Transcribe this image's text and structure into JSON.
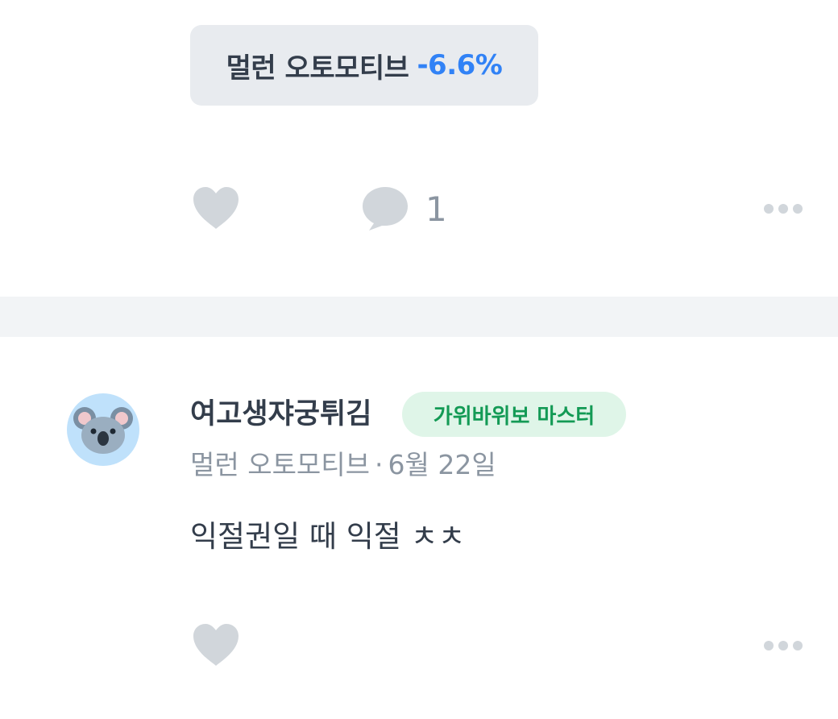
{
  "post": {
    "stock_tag": {
      "name": "멀런 오토모티브",
      "change": "-6.6%"
    },
    "actions": {
      "comment_count": "1"
    }
  },
  "comment": {
    "user": {
      "name": "여고생쟈궁튀김",
      "badge": "가위바위보 마스터",
      "avatar_icon": "koala-icon"
    },
    "meta": {
      "stock": "멀런 오토모티브",
      "separator": "·",
      "date": "6월 22일"
    },
    "text": "익절권일 때 익절 ㅊㅊ"
  },
  "colors": {
    "text_primary": "#333d4b",
    "text_secondary": "#8b95a1",
    "negative_change": "#3182f6",
    "chip_background": "#e8ebef",
    "badge_background": "#dff5e8",
    "badge_text": "#139a55",
    "icon_gray": "#d1d6db",
    "divider": "#f2f4f6"
  }
}
